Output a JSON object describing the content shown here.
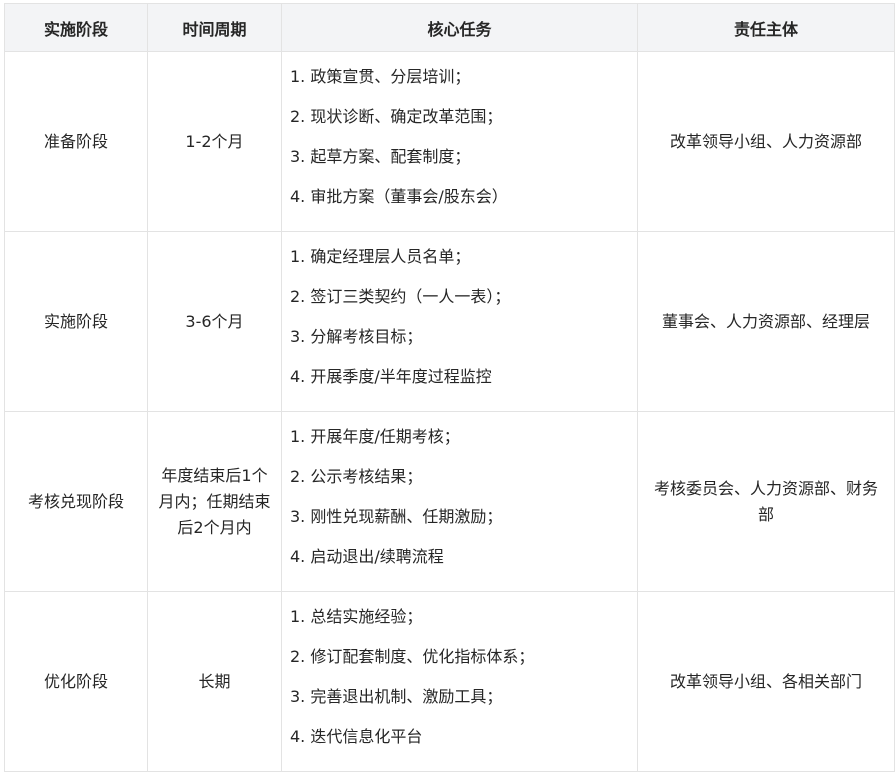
{
  "table": {
    "headers": [
      "实施阶段",
      "时间周期",
      "核心任务",
      "责任主体"
    ],
    "rows": [
      {
        "stage": "准备阶段",
        "period": "1-2个月",
        "tasks": [
          "1. 政策宣贯、分层培训；",
          "2. 现状诊断、确定改革范围；",
          "3. 起草方案、配套制度；",
          "4. 审批方案（董事会/股东会）"
        ],
        "owner": "改革领导小组、人力资源部"
      },
      {
        "stage": "实施阶段",
        "period": "3-6个月",
        "tasks": [
          "1. 确定经理层人员名单；",
          "2. 签订三类契约（一人一表）；",
          "3. 分解考核目标；",
          "4. 开展季度/半年度过程监控"
        ],
        "owner": "董事会、人力资源部、经理层"
      },
      {
        "stage": "考核兑现阶段",
        "period": "年度结束后1个月内；任期结束后2个月内",
        "tasks": [
          "1. 开展年度/任期考核；",
          "2. 公示考核结果；",
          "3. 刚性兑现薪酬、任期激励；",
          "4. 启动退出/续聘流程"
        ],
        "owner": "考核委员会、人力资源部、财务部"
      },
      {
        "stage": "优化阶段",
        "period": "长期",
        "tasks": [
          "1. 总结实施经验；",
          "2. 修订配套制度、优化指标体系；",
          "3. 完善退出机制、激励工具；",
          "4. 迭代信息化平台"
        ],
        "owner": "改革领导小组、各相关部门"
      }
    ]
  }
}
